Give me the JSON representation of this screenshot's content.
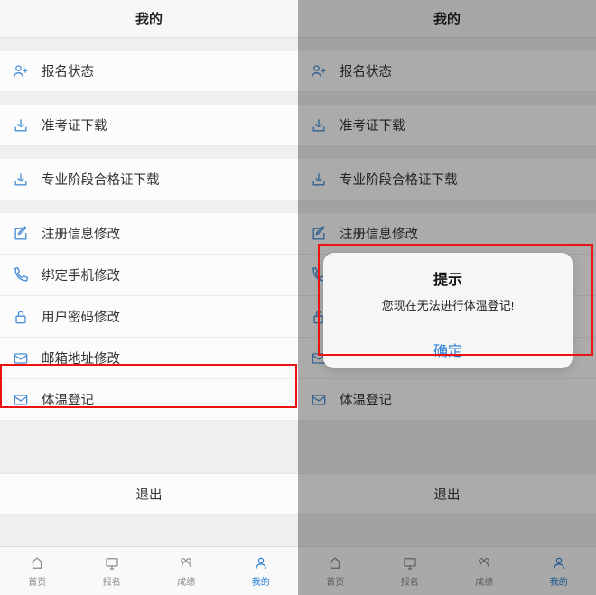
{
  "header_title": "我的",
  "menu": {
    "items": [
      {
        "label": "报名状态",
        "icon": "user-plus-icon"
      },
      {
        "label": "准考证下载",
        "icon": "download-icon"
      },
      {
        "label": "专业阶段合格证下载",
        "icon": "download-icon"
      },
      {
        "label": "注册信息修改",
        "icon": "edit-icon"
      },
      {
        "label": "绑定手机修改",
        "icon": "phone-icon"
      },
      {
        "label": "用户密码修改",
        "icon": "lock-icon"
      },
      {
        "label": "邮箱地址修改",
        "icon": "mail-icon"
      },
      {
        "label": "体温登记",
        "icon": "mail-icon"
      }
    ]
  },
  "logout_label": "退出",
  "tabs": [
    {
      "label": "首页",
      "icon": "home-icon"
    },
    {
      "label": "报名",
      "icon": "monitor-icon"
    },
    {
      "label": "成绩",
      "icon": "score-icon"
    },
    {
      "label": "我的",
      "icon": "person-icon"
    }
  ],
  "alert": {
    "title": "提示",
    "message": "您现在无法进行体温登记!",
    "ok": "确定"
  },
  "colors": {
    "accent": "#2a7fd5",
    "highlight": "#e11"
  }
}
